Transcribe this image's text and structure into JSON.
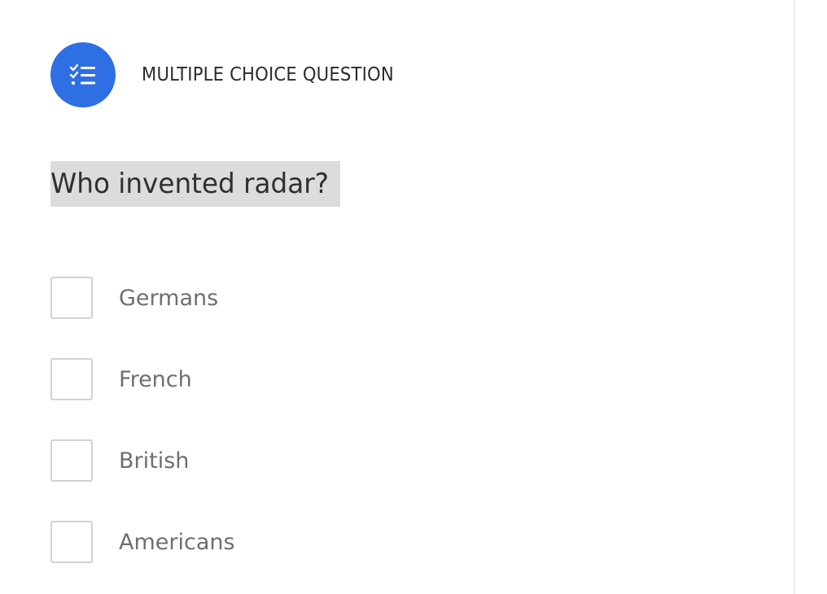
{
  "question_block": {
    "type_icon": "checklist-icon",
    "type_label": "MULTIPLE CHOICE QUESTION",
    "question_text": "Who invented radar?",
    "options": [
      {
        "label": "Germans",
        "checked": false
      },
      {
        "label": "French",
        "checked": false
      },
      {
        "label": "British",
        "checked": false
      },
      {
        "label": "Americans",
        "checked": false
      }
    ]
  },
  "colors": {
    "accent": "#2f6fe4",
    "question_highlight": "#dcdcdc",
    "option_text": "#6f6f6f",
    "checkbox_border": "#d2d2d2"
  }
}
